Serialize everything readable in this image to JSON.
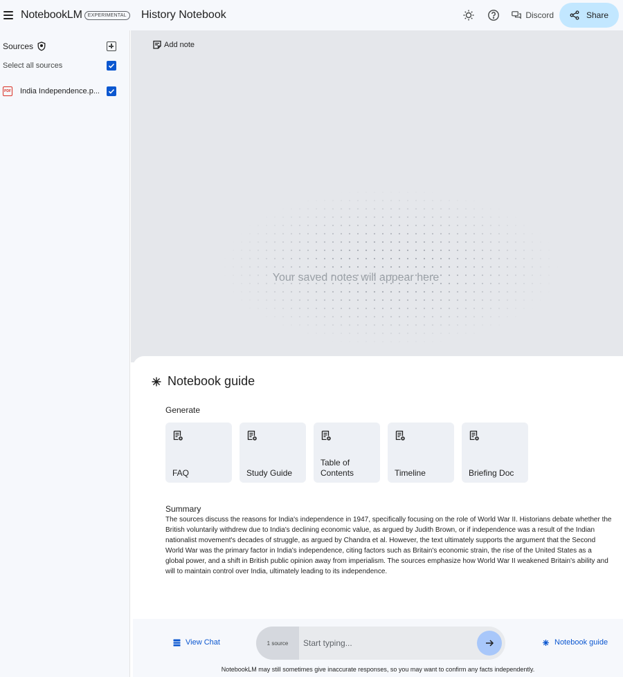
{
  "app": {
    "brand": "NotebookLM",
    "badge": "EXPERIMENTAL",
    "notebook_title": "History Notebook"
  },
  "header": {
    "discord_label": "Discord",
    "share_label": "Share",
    "icons": [
      "theme-icon",
      "help-icon",
      "discord-icon",
      "share-icon"
    ]
  },
  "sidebar": {
    "sources_label": "Sources",
    "select_all_label": "Select all sources",
    "select_all_checked": true,
    "files": [
      {
        "name": "India Independence.p...",
        "type": "pdf",
        "checked": true
      }
    ]
  },
  "notes": {
    "add_note_label": "Add note",
    "empty_message": "Your saved notes will appear here"
  },
  "guide": {
    "title": "Notebook guide",
    "generate_label": "Generate",
    "cards": [
      {
        "label": "FAQ"
      },
      {
        "label": "Study Guide"
      },
      {
        "label": "Table of Contents"
      },
      {
        "label": "Timeline"
      },
      {
        "label": "Briefing Doc"
      }
    ],
    "summary_title": "Summary",
    "summary_text": "The sources discuss the reasons for India's independence in 1947, specifically focusing on the role of World War II. Historians debate whether the British voluntarily withdrew due to India's declining economic value, as argued by Judith Brown, or if independence was a result of the Indian nationalist movement's decades of struggle, as argued by Chandra et al. However, the text ultimately supports the argument that the Second World War was the primary factor in India's independence, citing factors such as Britain's economic strain, the rise of the United States as a global power, and a shift in British public opinion away from imperialism. The sources emphasize how World War II weakened Britain's ability and will to maintain control over India, ultimately leading to its independence."
  },
  "bottom": {
    "view_chat_label": "View Chat",
    "source_pill": "1 source",
    "input_placeholder": "Start typing...",
    "input_value": "",
    "notebook_guide_label": "Notebook guide",
    "disclaimer": "NotebookLM may still sometimes give inaccurate responses, so you may want to confirm any facts independently."
  },
  "colors": {
    "accent": "#0b57d0",
    "share_bg": "#c2e7ff",
    "send_bg": "#a8c7fa",
    "notes_bg": "#e5e7eb",
    "sidebar_bg": "#f6f8fc"
  }
}
